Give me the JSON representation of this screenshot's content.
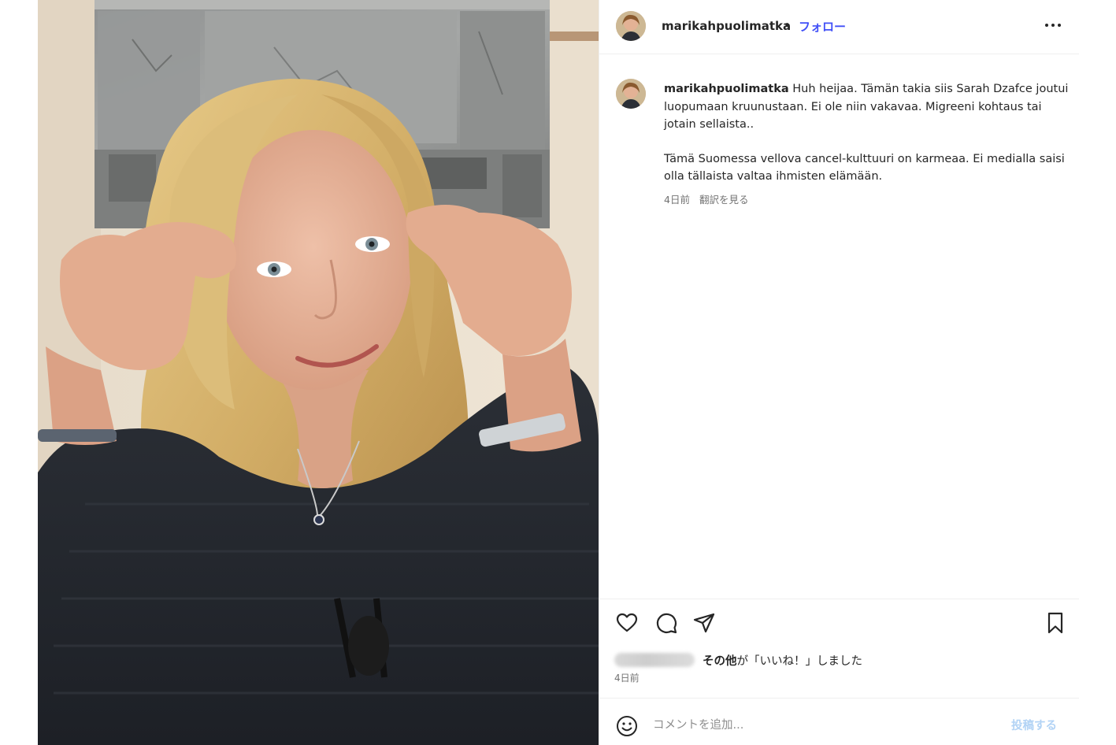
{
  "post": {
    "username": "marikahpuolimatka",
    "separator": "•",
    "follow_label": "フォロー",
    "more_icon": "more-horizontal-icon"
  },
  "caption": {
    "username": "marikahpuolimatka",
    "text_part1": "Huh heijaa. Tämän takia siis Sarah Dzafce joutui luopumaan kruunustaan. Ei ole niin vakavaa. Migreeni kohtaus tai jotain sellaista..",
    "text_part2": "Tämä Suomessa vellova cancel-kulttuuri on karmeaa. Ei medialla saisi olla tällaista valtaa ihmisten elämään.",
    "time": "4日前",
    "translate_label": "翻訳を見る"
  },
  "actions": {
    "like_icon": "heart-icon",
    "comment_icon": "comment-icon",
    "share_icon": "send-icon",
    "save_icon": "bookmark-icon"
  },
  "likes": {
    "others_label": "その他",
    "suffix": "が「いいね！」しました",
    "time": "4日前"
  },
  "comment_bar": {
    "emoji_icon": "emoji-icon",
    "placeholder": "コメントを追加...",
    "post_label": "投稿する"
  },
  "colors": {
    "link_blue": "#4150f7",
    "post_disabled": "#b2d3f5",
    "text": "#262626",
    "muted": "#737373"
  }
}
